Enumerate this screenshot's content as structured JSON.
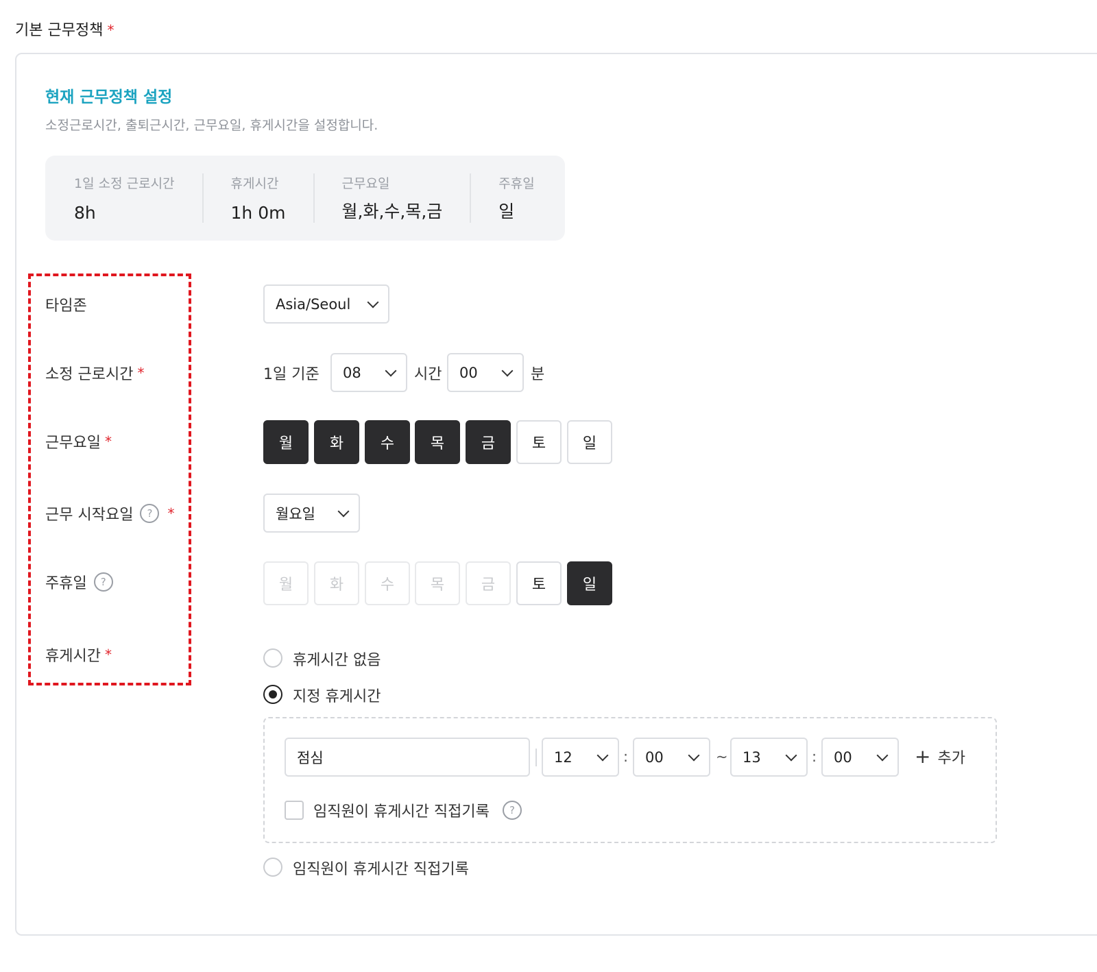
{
  "section": {
    "title": "기본 근무정책",
    "required_mark": "*"
  },
  "current": {
    "title": "현재 근무정책 설정",
    "description": "소정근로시간, 출퇴근시간, 근무요일, 휴게시간을 설정합니다.",
    "summary": [
      {
        "label": "1일 소정 근로시간",
        "value": "8h"
      },
      {
        "label": "휴게시간",
        "value": "1h 0m"
      },
      {
        "label": "근무요일",
        "value": "월,화,수,목,금"
      },
      {
        "label": "주휴일",
        "value": "일"
      }
    ]
  },
  "form": {
    "timezone": {
      "label": "타임존",
      "value": "Asia/Seoul"
    },
    "work_hours": {
      "label": "소정 근로시간",
      "required": "*",
      "prefix": "1일 기준",
      "hour_value": "08",
      "hour_unit": "시간",
      "minute_value": "00",
      "minute_unit": "분"
    },
    "work_days": {
      "label": "근무요일",
      "required": "*",
      "days": [
        {
          "label": "월",
          "state": "on"
        },
        {
          "label": "화",
          "state": "on"
        },
        {
          "label": "수",
          "state": "on"
        },
        {
          "label": "목",
          "state": "on"
        },
        {
          "label": "금",
          "state": "on"
        },
        {
          "label": "토",
          "state": "off"
        },
        {
          "label": "일",
          "state": "off"
        }
      ]
    },
    "start_day": {
      "label": "근무 시작요일",
      "help": "?",
      "required": "*",
      "value": "월요일"
    },
    "weekly_holiday": {
      "label": "주휴일",
      "help": "?",
      "days": [
        {
          "label": "월",
          "state": "disabled"
        },
        {
          "label": "화",
          "state": "disabled"
        },
        {
          "label": "수",
          "state": "disabled"
        },
        {
          "label": "목",
          "state": "disabled"
        },
        {
          "label": "금",
          "state": "disabled"
        },
        {
          "label": "토",
          "state": "off"
        },
        {
          "label": "일",
          "state": "on"
        }
      ]
    },
    "break_time": {
      "label": "휴게시간",
      "required": "*",
      "options": [
        {
          "label": "휴게시간 없음",
          "checked": false
        },
        {
          "label": "지정 휴게시간",
          "checked": true
        },
        {
          "label": "임직원이 휴게시간 직접기록",
          "checked": false
        }
      ],
      "entry": {
        "name": "점심",
        "start_hour": "12",
        "start_minute": "00",
        "range_sep": "~",
        "end_hour": "13",
        "end_minute": "00",
        "colon": ":",
        "add_label": "추가",
        "self_record_label": "임직원이 휴게시간 직접기록",
        "self_record_checked": false,
        "help": "?"
      }
    }
  }
}
